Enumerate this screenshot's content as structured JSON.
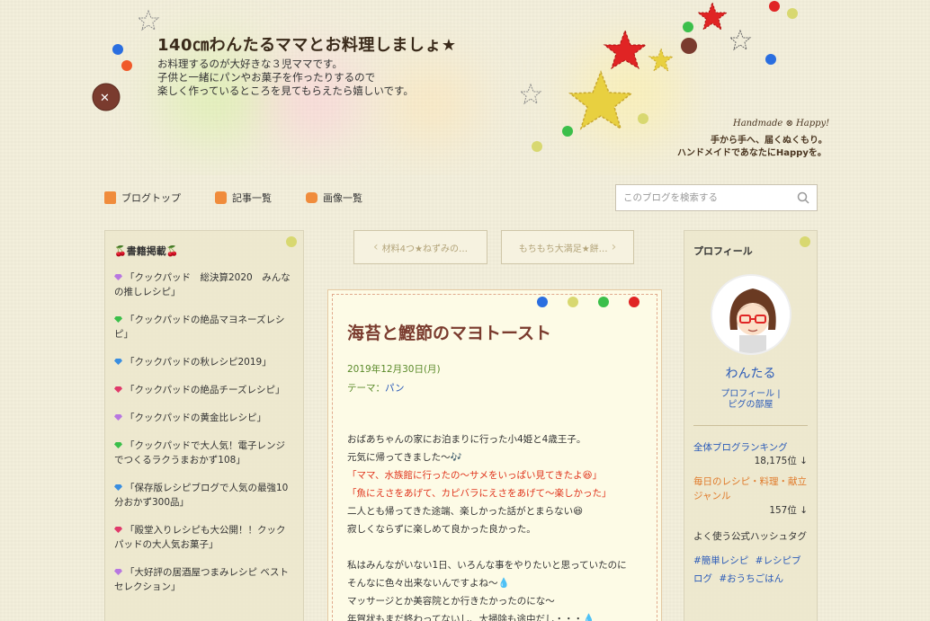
{
  "header": {
    "title": "140㎝わんたるママとお料理しましょ★",
    "description": [
      "お料理するのが大好きな３児ママです。",
      "子供と一緒にパンやお菓子を作ったりするので",
      "楽しく作っているところを見てもらえたら嬉しいです。"
    ],
    "tagline_en": "Handmade ⊗ Happy!",
    "tagline_1": "手から手へ、届くぬくもり。",
    "tagline_2": "ハンドメイドであなたにHappyを。"
  },
  "nav": {
    "blog_top": "ブログトップ",
    "articles": "記事一覧",
    "images": "画像一覧"
  },
  "search": {
    "placeholder": "このブログを検索する"
  },
  "pager": {
    "prev": "材料4つ★ねずみの…",
    "next": "もちもち大満足★餅…"
  },
  "left_panel": {
    "heading": "🍒書籍掲載🍒",
    "items": [
      {
        "label": "「クックパッド　総決算2020　みんなの推しレシピ」",
        "gem": "#b877e0"
      },
      {
        "label": "「クックパッドの絶品マヨネーズレシピ」",
        "gem": "#3bbf4a"
      },
      {
        "label": "「クックパッドの秋レシピ2019」",
        "gem": "#3a8ee0"
      },
      {
        "label": "「クックパッドの絶品チーズレシピ」",
        "gem": "#e03a6a"
      },
      {
        "label": "「クックパッドの黄金比レシピ」",
        "gem": "#b877e0"
      },
      {
        "label": "「クックパッドで大人気！電子レンジでつくるラクうまおかず108」",
        "gem": "#3bbf4a"
      },
      {
        "label": "「保存版レシピブログで人気の最強10分おかず300品」",
        "gem": "#3a8ee0"
      },
      {
        "label": "「殿堂入りレシピも大公開！！クックパッドの大人気お菓子」",
        "gem": "#e03a6a"
      },
      {
        "label": "「大好評の居酒屋つまみレシピ ベストセレクション」",
        "gem": "#b877e0"
      }
    ]
  },
  "article": {
    "title": "海苔と鰹節のマヨトースト",
    "date": "2019年12月30日(月)",
    "theme_label": "テーマ：",
    "theme_link": "パン",
    "lines": [
      {
        "text": "おばあちゃんの家にお泊まりに行った小4姫と4歳王子。",
        "red": false
      },
      {
        "text": "元気に帰ってきました〜🎶",
        "red": false
      },
      {
        "text": "「ママ、水族館に行ったの〜サメをいっぱい見てきたよ😆」",
        "red": true
      },
      {
        "text": "「魚にえさをあげて、カピバラにえさをあげて〜楽しかった」",
        "red": true
      },
      {
        "text": "二人とも帰ってきた途端、楽しかった話がとまらない😆",
        "red": false
      },
      {
        "text": "寂しくならずに楽しめて良かった良かった。",
        "red": false
      },
      {
        "text": "",
        "red": false
      },
      {
        "text": "私はみんながいない1日、いろんな事をやりたいと思っていたのに",
        "red": false
      },
      {
        "text": "そんなに色々出来ないんですよね〜💧",
        "red": false
      },
      {
        "text": "マッサージとか美容院とか行きたかったのにな〜",
        "red": false
      },
      {
        "text": "年賀状もまだ終わってないし、大掃除も途中だし・・・💧",
        "red": false
      }
    ]
  },
  "profile": {
    "heading": "プロフィール",
    "name": "わんたる",
    "link_profile": "プロフィール",
    "link_room": "ピグの部屋",
    "ranking_label": "全体ブログランキング",
    "ranking_value": "18,175位 ↓",
    "genre_label": "毎日のレシピ・料理・献立ジャンル",
    "genre_value": "157位 ↓",
    "hashtag_title": "よく使う公式ハッシュタグ",
    "hashtags": [
      "#簡単レシピ",
      "#レシピブログ",
      "#おうちごはん"
    ]
  },
  "colors": {
    "accent_orange": "#f08c3c",
    "link_blue": "#2a5ab8",
    "title_brown": "#7a3b2e",
    "date_green": "#5a8a2a",
    "red_text": "#e0341c"
  }
}
